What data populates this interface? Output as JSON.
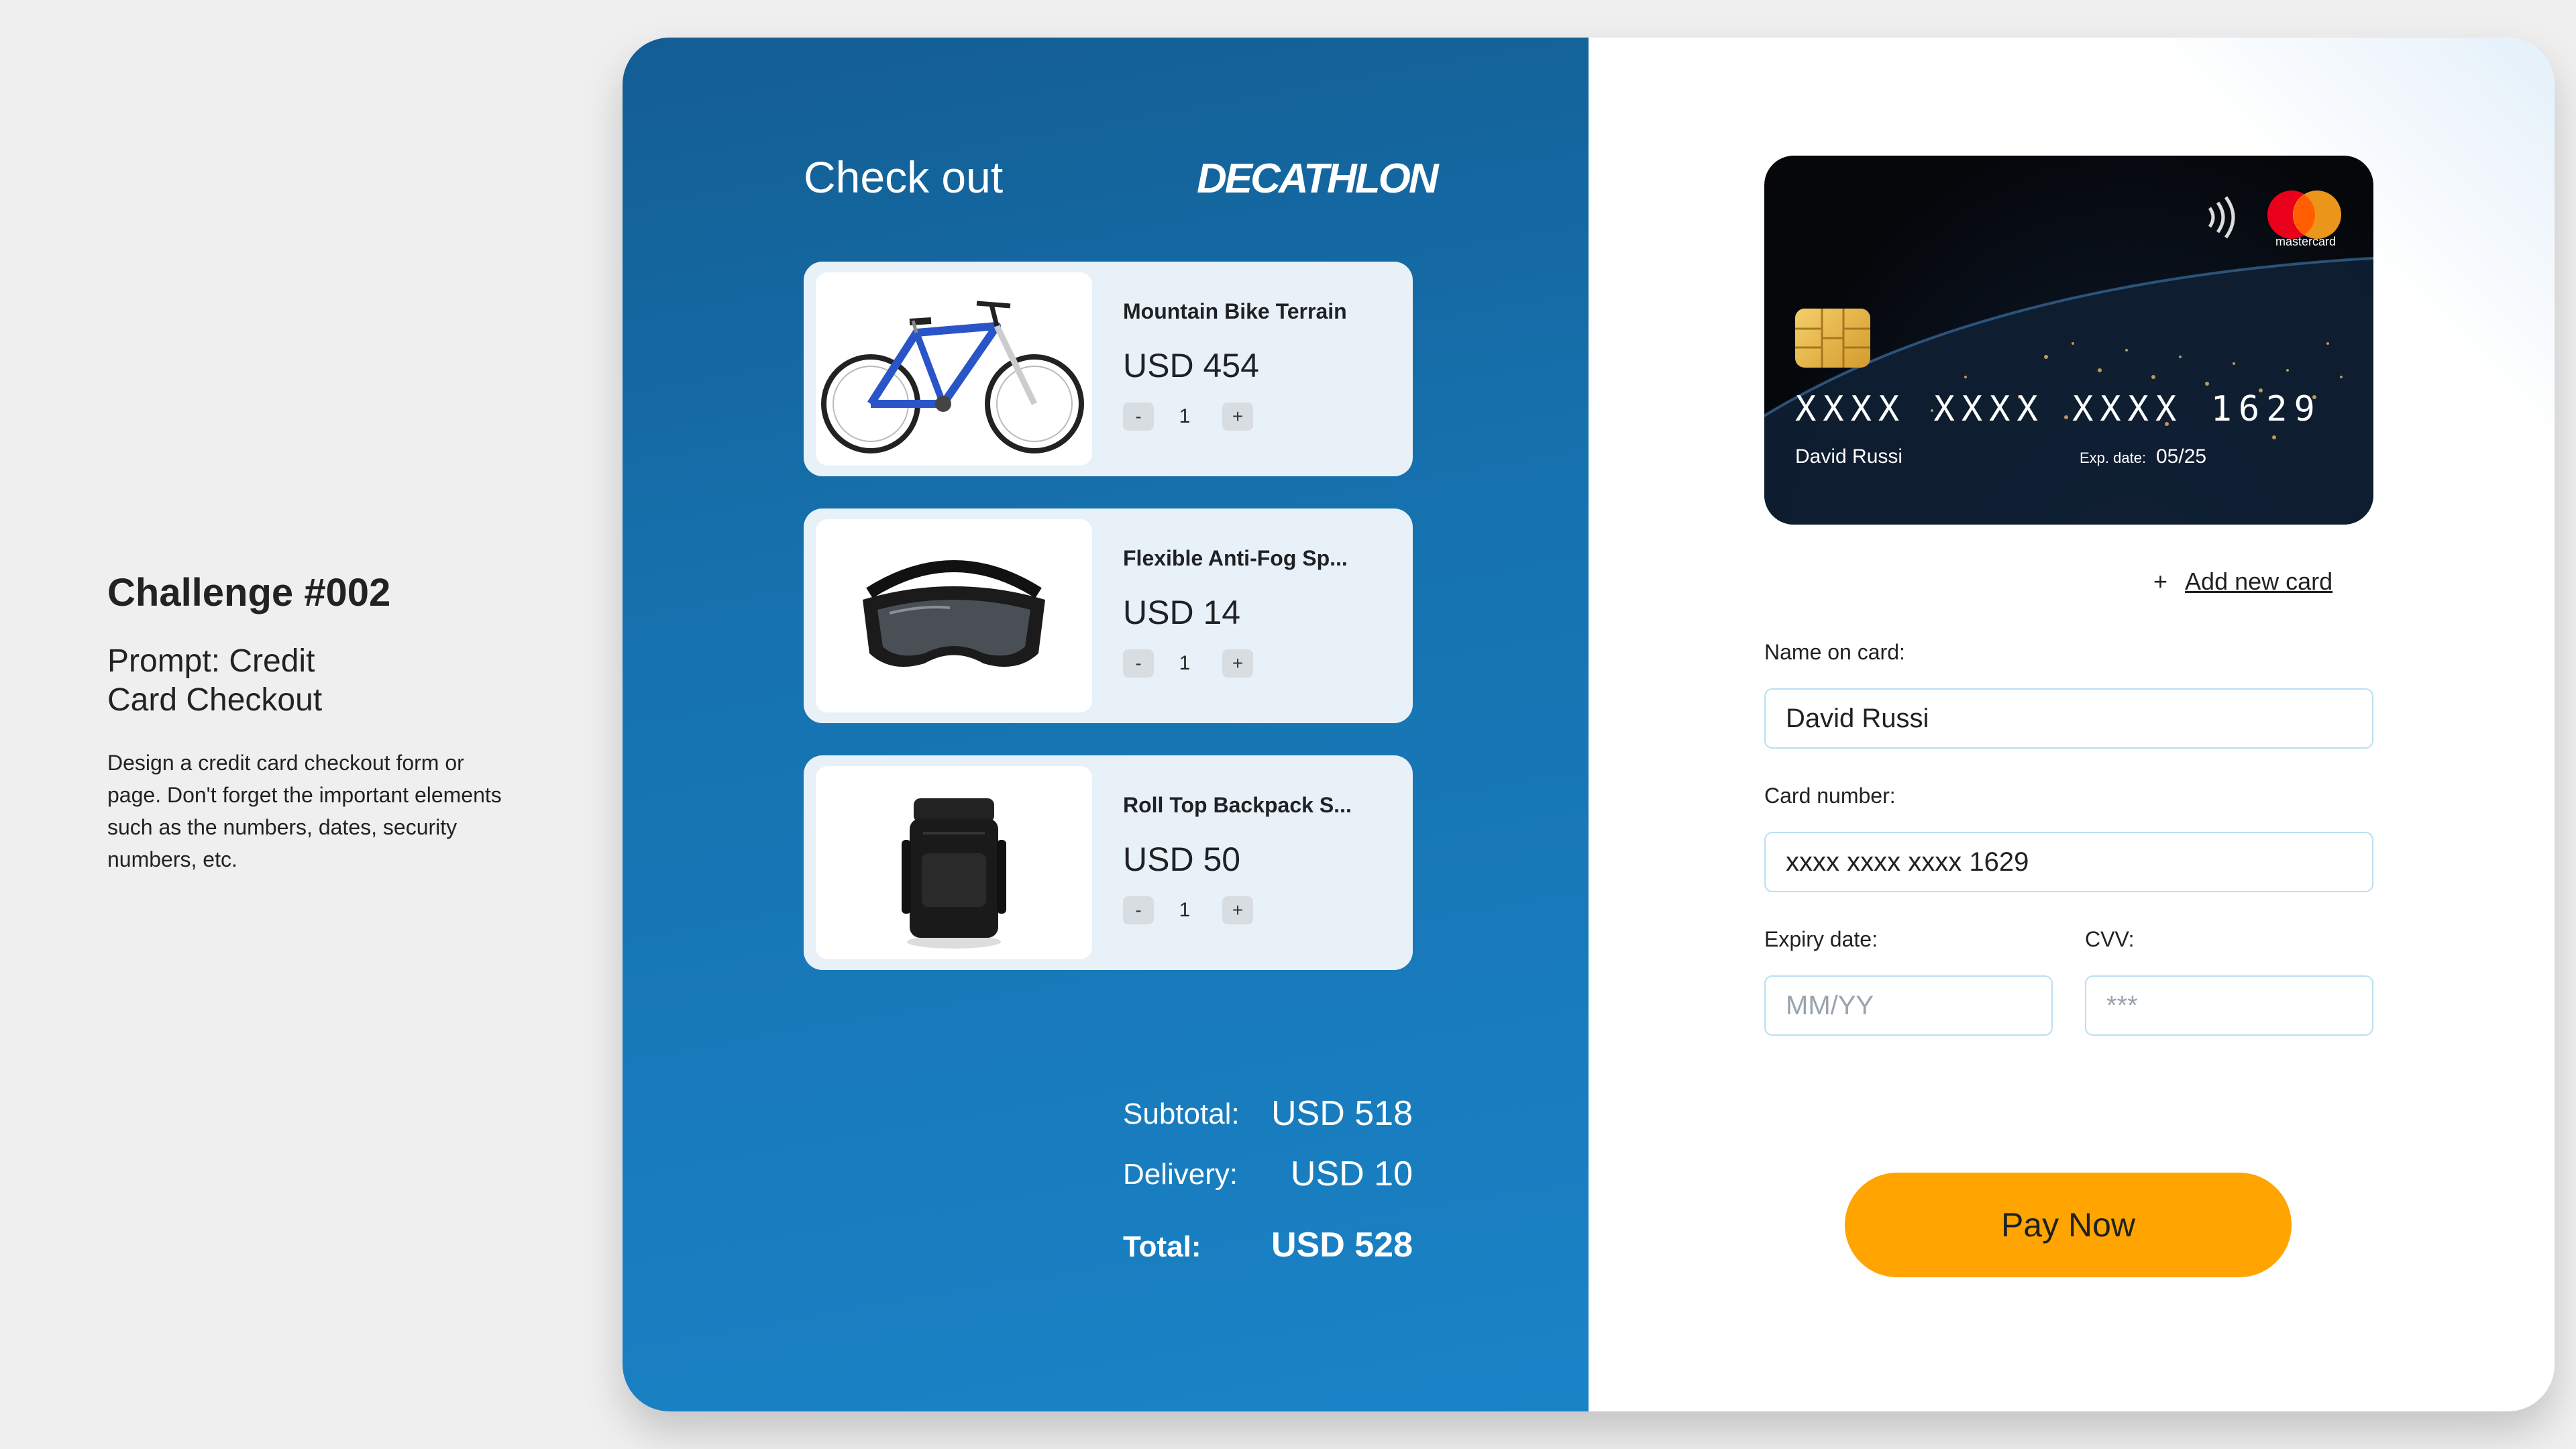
{
  "intro": {
    "title": "Challenge #002",
    "prompt": "Prompt: Credit Card Checkout",
    "description": "Design a credit card checkout form or page. Don't forget the important elements such as the numbers, dates, security numbers, etc."
  },
  "checkout": {
    "title": "Check out",
    "brand": "DECATHLON",
    "items": [
      {
        "name": "Mountain Bike Terrain",
        "price": "USD 454",
        "qty": "1",
        "minus": "-",
        "plus": "+",
        "image": "bike-image"
      },
      {
        "name": "Flexible Anti-Fog Sp...",
        "price": "USD 14",
        "qty": "1",
        "minus": "-",
        "plus": "+",
        "image": "goggles-image"
      },
      {
        "name": "Roll Top Backpack S...",
        "price": "USD 50",
        "qty": "1",
        "minus": "-",
        "plus": "+",
        "image": "backpack-image"
      }
    ],
    "summary": {
      "subtotal_label": "Subtotal:",
      "subtotal_value": "USD 518",
      "delivery_label": "Delivery:",
      "delivery_value": "USD 10",
      "total_label": "Total:",
      "total_value": "USD 528"
    }
  },
  "card": {
    "number": "XXXX XXXX XXXX 1629",
    "holder": "David Russi",
    "exp_label": "Exp. date:",
    "exp_value": "05/25",
    "network": "mastercard"
  },
  "form": {
    "add_card_plus": "+",
    "add_card_label": "Add new card",
    "name_label": "Name on card:",
    "name_value": "David Russi",
    "number_label": "Card number:",
    "number_value": "xxxx xxxx xxxx 1629",
    "expiry_label": "Expiry date:",
    "expiry_placeholder": "MM/YY",
    "cvv_label": "CVV:",
    "cvv_placeholder": "***",
    "pay_label": "Pay Now"
  },
  "colors": {
    "panel_blue": "#1672af",
    "pay_button": "#ffa400",
    "field_border": "#b9dff2"
  }
}
